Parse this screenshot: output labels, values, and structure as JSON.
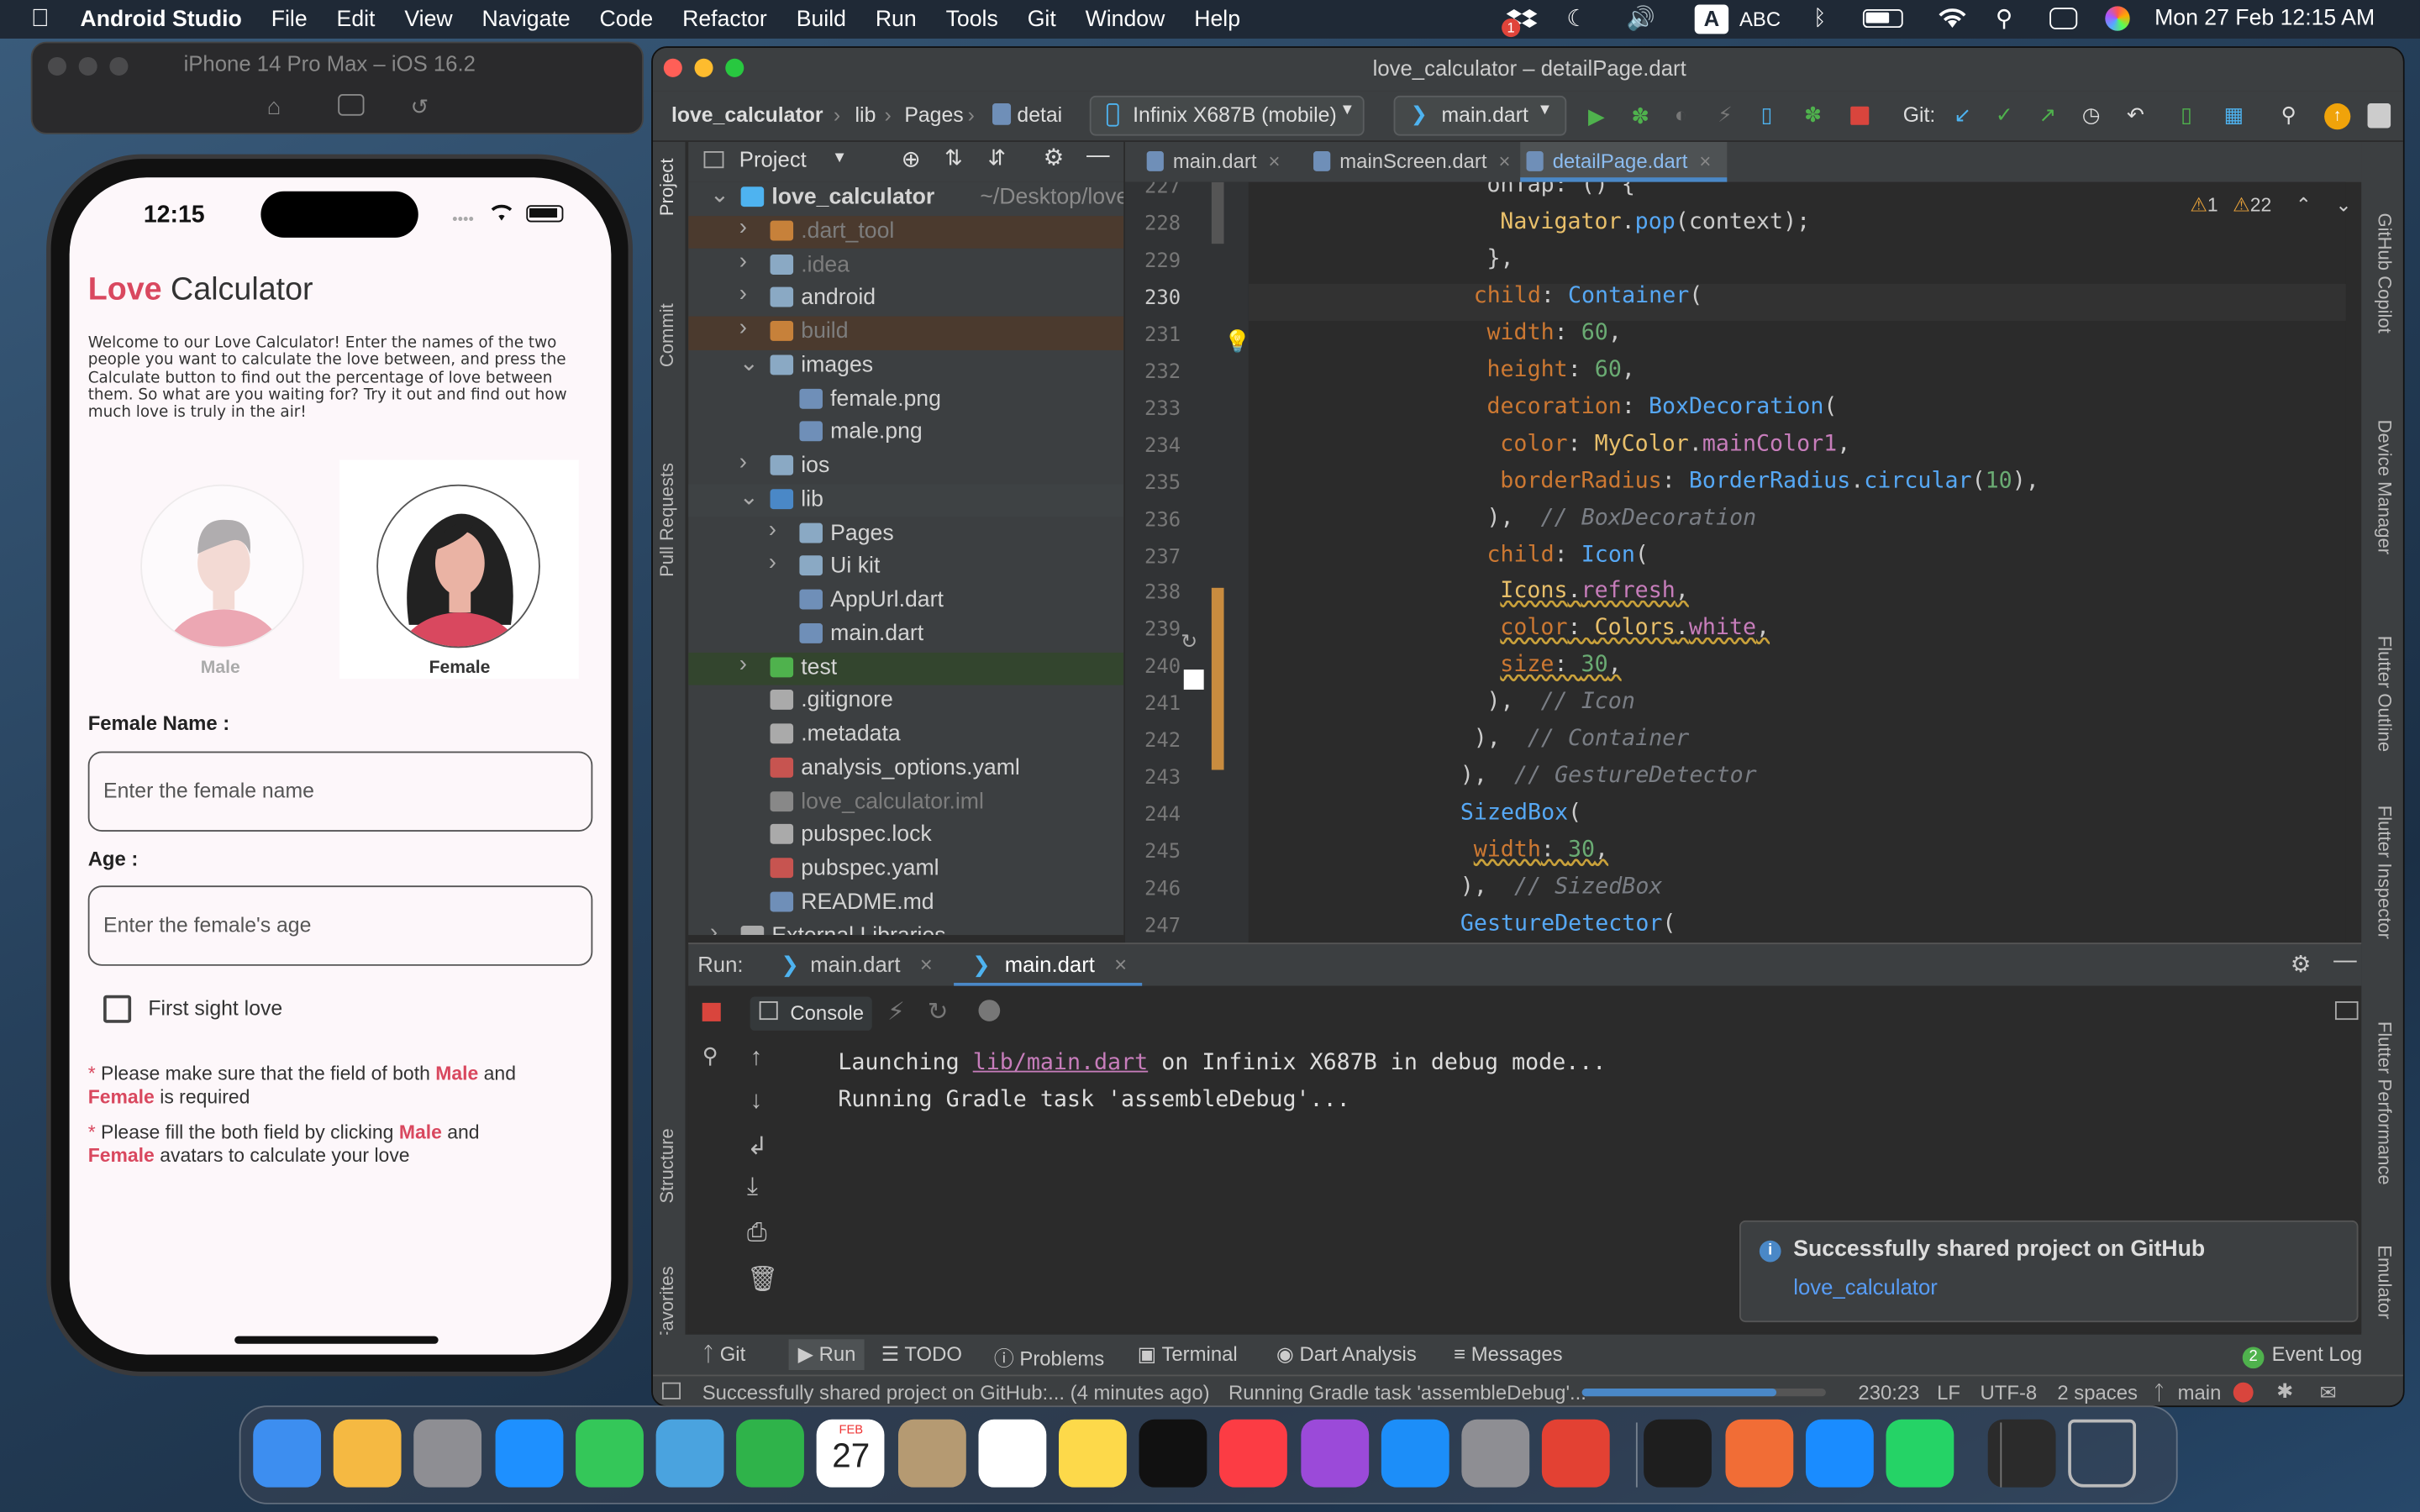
{
  "menubar": {
    "app": "Android Studio",
    "items": [
      "File",
      "Edit",
      "View",
      "Navigate",
      "Code",
      "Refactor",
      "Build",
      "Run",
      "Tools",
      "Git",
      "Window",
      "Help"
    ],
    "input_source": "ABC",
    "datetime": "Mon 27 Feb  12:15 AM",
    "notification_badge": "1"
  },
  "simulator": {
    "title": "iPhone 14 Pro Max – iOS 16.2",
    "time": "12:15",
    "app": {
      "title_accent": "Love",
      "title_rest": " Calculator",
      "intro": [
        "Welcome to our Love Calculator! Enter the names of the two",
        "people you want to calculate the love between, and press the",
        "Calculate button to find out the percentage of love between",
        "them. So what are you waiting for? Try it out and find out how",
        "much love is truly in the air!"
      ],
      "male_label": "Male",
      "female_label": "Female",
      "female_name_label": "Female Name :",
      "female_name_placeholder": "Enter the female name",
      "age_label": "Age :",
      "age_placeholder": "Enter the female's age",
      "checkbox_label": "First sight love",
      "notes": [
        {
          "a": "Please make sure that the field of both ",
          "b": "Male",
          "c": " and",
          "d": "Female",
          "e": " is required"
        },
        {
          "a": "Please fill the both field by clicking ",
          "b": "Male",
          "c": " and",
          "d": "Female",
          "e": " avatars to calculate your love"
        }
      ],
      "accent": "#d9485f"
    }
  },
  "ide": {
    "title": "love_calculator – detailPage.dart",
    "breadcrumb": [
      "love_calculator",
      "lib",
      "Pages",
      "detai"
    ],
    "device": "Infinix X687B (mobile)",
    "run_config": "main.dart",
    "git_label": "Git:",
    "project_label": "Project",
    "vtabs_left": [
      "Project",
      "Commit",
      "Pull Requests",
      "Structure",
      "Favorites"
    ],
    "vtabs_right": [
      "GitHub Copilot",
      "Device Manager",
      "Flutter Outline",
      "Flutter Inspector",
      "Flutter Performance",
      "Emulator"
    ],
    "tree": [
      {
        "d": 0,
        "a": "v",
        "n": "love_calculator",
        "extra": "~/Desktop/love_ca",
        "type": "module",
        "bold": true
      },
      {
        "d": 1,
        "a": ">",
        "n": ".dart_tool",
        "type": "folder-ex"
      },
      {
        "d": 1,
        "a": ">",
        "n": ".idea",
        "type": "folder-dim"
      },
      {
        "d": 1,
        "a": ">",
        "n": "android",
        "type": "folder"
      },
      {
        "d": 1,
        "a": ">",
        "n": "build",
        "type": "folder-ex"
      },
      {
        "d": 1,
        "a": "v",
        "n": "images",
        "type": "folder"
      },
      {
        "d": 2,
        "a": "",
        "n": "female.png",
        "type": "img"
      },
      {
        "d": 2,
        "a": "",
        "n": "male.png",
        "type": "img"
      },
      {
        "d": 1,
        "a": ">",
        "n": "ios",
        "type": "folder"
      },
      {
        "d": 1,
        "a": "v",
        "n": "lib",
        "type": "folder-src"
      },
      {
        "d": 2,
        "a": ">",
        "n": "Pages",
        "type": "folder"
      },
      {
        "d": 2,
        "a": ">",
        "n": "Ui kit",
        "type": "folder"
      },
      {
        "d": 2,
        "a": "",
        "n": "AppUrl.dart",
        "type": "dart"
      },
      {
        "d": 2,
        "a": "",
        "n": "main.dart",
        "type": "dart"
      },
      {
        "d": 1,
        "a": ">",
        "n": "test",
        "type": "folder-test"
      },
      {
        "d": 1,
        "a": "",
        "n": ".gitignore",
        "type": "file"
      },
      {
        "d": 1,
        "a": "",
        "n": ".metadata",
        "type": "file"
      },
      {
        "d": 1,
        "a": "",
        "n": "analysis_options.yaml",
        "type": "yaml"
      },
      {
        "d": 1,
        "a": "",
        "n": "love_calculator.iml",
        "type": "file-dim"
      },
      {
        "d": 1,
        "a": "",
        "n": "pubspec.lock",
        "type": "file"
      },
      {
        "d": 1,
        "a": "",
        "n": "pubspec.yaml",
        "type": "yaml"
      },
      {
        "d": 1,
        "a": "",
        "n": "README.md",
        "type": "md"
      },
      {
        "d": 0,
        "a": ">",
        "n": "External Libraries",
        "type": "lib"
      }
    ],
    "tabs": [
      {
        "label": "main.dart",
        "active": false
      },
      {
        "label": "mainScreen.dart",
        "active": false
      },
      {
        "label": "detailPage.dart",
        "active": true
      }
    ],
    "inspections": {
      "warn1": "1",
      "warn2": "22"
    },
    "lines": [
      {
        "n": "227",
        "ind": 14,
        "t": [
          [
            "onTap: () {",
            "#ccc"
          ]
        ]
      },
      {
        "n": "228",
        "ind": 15,
        "t": [
          [
            "Navigator",
            ""
          ],
          [
            ".",
            "#ccc"
          ],
          [
            "pop",
            "#56a8f5"
          ],
          [
            "(context);",
            "#ccc"
          ]
        ]
      },
      {
        "n": "229",
        "ind": 14,
        "t": [
          [
            "},",
            "#ccc"
          ]
        ]
      },
      {
        "n": "230",
        "ind": 13,
        "t": [
          [
            "child",
            "#cc7832"
          ],
          [
            ": ",
            "#ccc"
          ],
          [
            "Container",
            "#56a8f5"
          ],
          [
            "(",
            "#ccc"
          ]
        ]
      },
      {
        "n": "231",
        "ind": 14,
        "t": [
          [
            "width",
            "#cc7832"
          ],
          [
            ": ",
            "#ccc"
          ],
          [
            "60",
            "#6aab73"
          ],
          [
            ",",
            "#ccc"
          ]
        ]
      },
      {
        "n": "232",
        "ind": 14,
        "t": [
          [
            "height",
            "#cc7832"
          ],
          [
            ": ",
            "#ccc"
          ],
          [
            "60",
            "#6aab73"
          ],
          [
            ",",
            "#ccc"
          ]
        ]
      },
      {
        "n": "233",
        "ind": 14,
        "t": [
          [
            "decoration",
            "#cc7832"
          ],
          [
            ": ",
            "#ccc"
          ],
          [
            "BoxDecoration",
            "#56a8f5"
          ],
          [
            "(",
            "#ccc"
          ]
        ]
      },
      {
        "n": "234",
        "ind": 15,
        "t": [
          [
            "color",
            "#cc7832"
          ],
          [
            ": ",
            "#ccc"
          ],
          [
            "MyColor",
            ""
          ],
          [
            ".",
            "#ccc"
          ],
          [
            "mainColor1",
            "#c77dbb"
          ],
          [
            ",",
            "#ccc"
          ]
        ]
      },
      {
        "n": "235",
        "ind": 15,
        "t": [
          [
            "borderRadius",
            "#cc7832"
          ],
          [
            ": ",
            "#ccc"
          ],
          [
            "BorderRadius",
            "#56a8f5"
          ],
          [
            ".",
            "#ccc"
          ],
          [
            "circular",
            "#56a8f5"
          ],
          [
            "(",
            "#ccc"
          ],
          [
            "10",
            "#6aab73"
          ],
          [
            "),",
            "#ccc"
          ]
        ]
      },
      {
        "n": "236",
        "ind": 14,
        "t": [
          [
            "),  ",
            "#ccc"
          ],
          [
            "// BoxDecoration",
            "#7a7e85"
          ]
        ]
      },
      {
        "n": "237",
        "ind": 14,
        "t": [
          [
            "child",
            "#cc7832"
          ],
          [
            ": ",
            "#ccc"
          ],
          [
            "Icon",
            "#56a8f5"
          ],
          [
            "(",
            "#ccc"
          ]
        ]
      },
      {
        "n": "238",
        "ind": 15,
        "t": [
          [
            "Icons",
            ""
          ],
          [
            ".",
            "#ccc"
          ],
          [
            "refresh",
            "#c77dbb"
          ],
          [
            ",",
            "#ccc"
          ]
        ],
        "wavy": true
      },
      {
        "n": "239",
        "ind": 15,
        "t": [
          [
            "color",
            "#cc7832"
          ],
          [
            ": ",
            "#ccc"
          ],
          [
            "Colors",
            ""
          ],
          [
            ".",
            "#ccc"
          ],
          [
            "white",
            "#c77dbb"
          ],
          [
            ",",
            "#ccc"
          ]
        ],
        "wavy": true
      },
      {
        "n": "240",
        "ind": 15,
        "t": [
          [
            "size",
            "#cc7832"
          ],
          [
            ": ",
            "#ccc"
          ],
          [
            "30",
            "#6aab73"
          ],
          [
            ",",
            "#ccc"
          ]
        ],
        "wavy": true
      },
      {
        "n": "241",
        "ind": 14,
        "t": [
          [
            "),  ",
            "#ccc"
          ],
          [
            "// Icon",
            "#7a7e85"
          ]
        ]
      },
      {
        "n": "242",
        "ind": 13,
        "t": [
          [
            "),  ",
            "#ccc"
          ],
          [
            "// Container",
            "#7a7e85"
          ]
        ]
      },
      {
        "n": "243",
        "ind": 12,
        "t": [
          [
            "),  ",
            "#ccc"
          ],
          [
            "// GestureDetector",
            "#7a7e85"
          ]
        ]
      },
      {
        "n": "244",
        "ind": 12,
        "t": [
          [
            "SizedBox",
            "#56a8f5"
          ],
          [
            "(",
            "#ccc"
          ]
        ]
      },
      {
        "n": "245",
        "ind": 13,
        "t": [
          [
            "width",
            "#cc7832"
          ],
          [
            ": ",
            "#ccc"
          ],
          [
            "30",
            "#6aab73"
          ],
          [
            ",",
            "#ccc"
          ]
        ],
        "wavy": true
      },
      {
        "n": "246",
        "ind": 12,
        "t": [
          [
            "),  ",
            "#ccc"
          ],
          [
            "// SizedBox",
            "#7a7e85"
          ]
        ]
      },
      {
        "n": "247",
        "ind": 12,
        "t": [
          [
            "GestureDetector",
            "#56a8f5"
          ],
          [
            "(",
            "#ccc"
          ]
        ]
      }
    ],
    "run": {
      "label": "Run:",
      "tabs": [
        "main.dart",
        "main.dart"
      ],
      "console_tab": "Console",
      "console": [
        {
          "pre": "Launching ",
          "link": "lib/main.dart",
          "post": " on Infinix X687B in debug mode..."
        },
        {
          "pre": "Running Gradle task 'assembleDebug'...",
          "link": "",
          "post": ""
        }
      ]
    },
    "bottom_tabs": [
      "Git",
      "Run",
      "TODO",
      "Problems",
      "Terminal",
      "Dart Analysis",
      "Messages"
    ],
    "event_log": "Event Log",
    "event_log_count": "2",
    "notification": {
      "title": "Successfully shared project on GitHub",
      "link": "love_calculator"
    },
    "status": {
      "message": "Successfully shared project on GitHub:... (4 minutes ago)",
      "task": "Running Gradle task 'assembleDebug'...",
      "position": "230:23",
      "line_sep": "LF",
      "encoding": "UTF-8",
      "indent": "2 spaces",
      "branch": "main"
    }
  },
  "dock": {
    "calendar_month": "FEB",
    "calendar_day": "27",
    "apps": [
      "Finder",
      "Photos",
      "Launchpad",
      "Safari",
      "Messages",
      "Maps",
      "FaceTime",
      "Calendar",
      "Contacts",
      "Reminders",
      "Notes",
      "TV",
      "Music",
      "Podcasts",
      "App Store",
      "System Settings",
      "Chrome",
      "Xcode Instruments",
      "Pages",
      "Xcode",
      "WhatsApp",
      "Preview",
      "Trash"
    ]
  },
  "colors": {
    "accent": "#d9485f",
    "ide_bg": "#2b2b2b",
    "ide_panel": "#3c3f41",
    "link": "#589df6"
  }
}
